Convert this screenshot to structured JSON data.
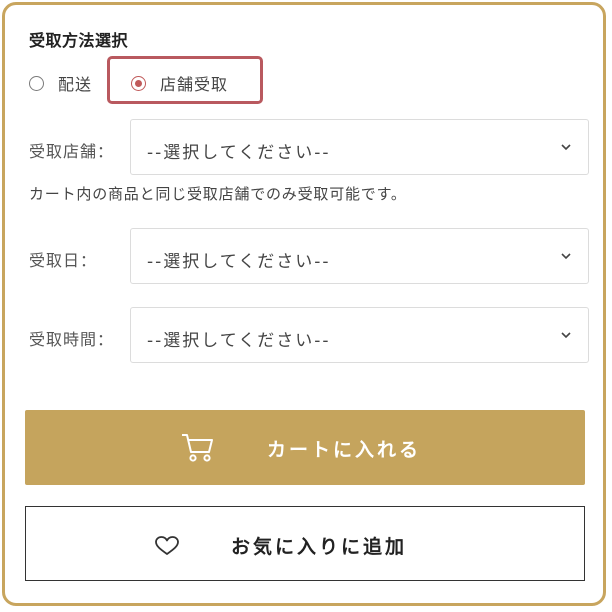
{
  "receive_method": {
    "title": "受取方法選択",
    "options": [
      {
        "label": "配送",
        "selected": false
      },
      {
        "label": "店舗受取",
        "selected": true
      }
    ]
  },
  "store_select": {
    "label": "受取店舗：",
    "value": "--選択してください--"
  },
  "store_note": "カート内の商品と同じ受取店舗でのみ受取可能です。",
  "date_select": {
    "label": "受取日：",
    "value": "--選択してください--"
  },
  "time_select": {
    "label": "受取時間：",
    "value": "--選択してください--"
  },
  "cart_button": {
    "label": "カートに入れる",
    "icon": "cart-icon"
  },
  "favorite_button": {
    "label": "お気に入りに追加",
    "icon": "heart-icon"
  },
  "colors": {
    "accent": "#c5a45d",
    "highlight": "#b9595f",
    "radio_selected": "#c05a5a"
  }
}
